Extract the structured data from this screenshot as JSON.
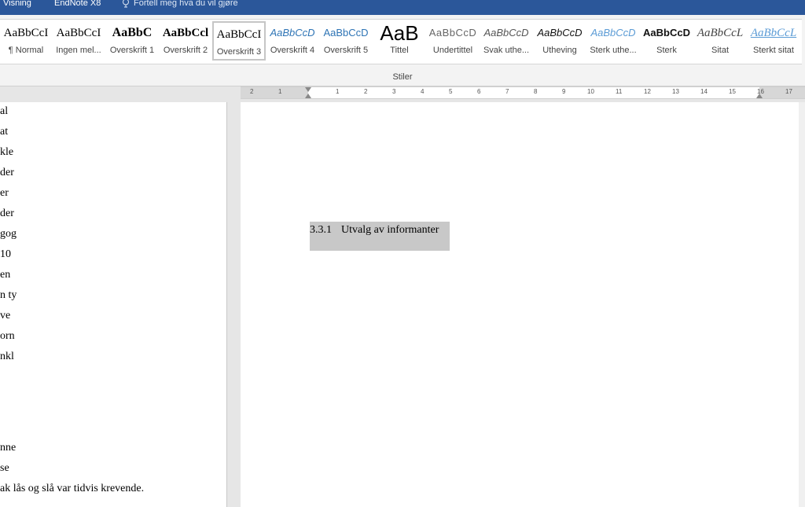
{
  "tabs": {
    "view": "Visning",
    "endnote": "EndNote X8",
    "tell_me": "Fortell meg hva du vil gjøre"
  },
  "styles_gallery": {
    "group_label": "Stiler",
    "items": [
      {
        "preview": "AaBbCcI",
        "name": "¶ Normal"
      },
      {
        "preview": "AaBbCcI",
        "name": "Ingen mel..."
      },
      {
        "preview": "AaBbC",
        "name": "Overskrift 1"
      },
      {
        "preview": "AaBbCcl",
        "name": "Overskrift 2"
      },
      {
        "preview": "AaBbCcI",
        "name": "Overskrift 3"
      },
      {
        "preview": "AaBbCcD",
        "name": "Overskrift 4"
      },
      {
        "preview": "AaBbCcD",
        "name": "Overskrift 5"
      },
      {
        "preview": "AaB",
        "name": "Tittel"
      },
      {
        "preview": "AaBbCcD",
        "name": "Undertittel"
      },
      {
        "preview": "AaBbCcD",
        "name": "Svak uthe..."
      },
      {
        "preview": "AaBbCcD",
        "name": "Utheving"
      },
      {
        "preview": "AaBbCcD",
        "name": "Sterk uthe..."
      },
      {
        "preview": "AaBbCcD",
        "name": "Sterk"
      },
      {
        "preview": "AaBbCcL",
        "name": "Sitat"
      },
      {
        "preview": "AaBbCcL",
        "name": "Sterkt sitat"
      }
    ],
    "selected": "Overskrift 3"
  },
  "ruler": {
    "left_numbers": [
      "2",
      "1"
    ],
    "numbers": [
      "1",
      "2",
      "3",
      "4",
      "5",
      "6",
      "7",
      "8",
      "9",
      "10",
      "11",
      "12",
      "13",
      "14",
      "15",
      "16",
      "17"
    ]
  },
  "left_pane": {
    "lines": [
      "al",
      "at",
      "kle",
      "der",
      "er",
      "der",
      "gog",
      "10",
      "en",
      "n ty",
      "ve",
      "orn",
      "nkl",
      "nne",
      "se",
      "ak lås og slå var tidvis krevende."
    ]
  },
  "document": {
    "heading_number": "3.3.1",
    "heading_text": "Utvalg av informanter"
  },
  "colors": {
    "title_bar": "#2b579a",
    "heading_shade": "#c8c8c8"
  }
}
